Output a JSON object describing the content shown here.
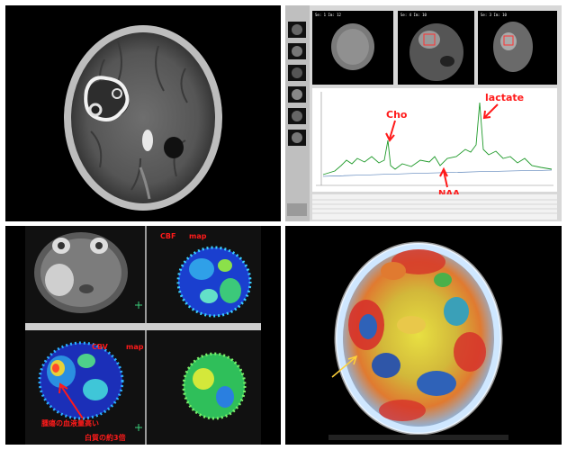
{
  "mrs": {
    "peak_labels": {
      "cho": "Cho",
      "naa": "NAA",
      "lactate": "lactate"
    }
  },
  "perfusion": {
    "cbf_label": "CBF",
    "cbf_suffix": "map",
    "cbv_label": "CBV",
    "cbv_suffix": "map",
    "annotation_line1": "腫瘍の血液量高い",
    "annotation_line2": "白質の約3倍"
  },
  "colors": {
    "annotation_red": "#ff1a1a",
    "arrow_yellow": "#ffd23a",
    "spectrum_green": "#1f9a2a"
  }
}
